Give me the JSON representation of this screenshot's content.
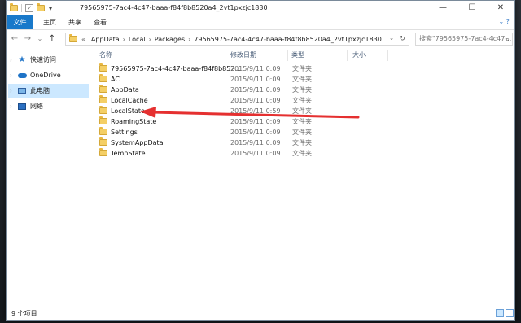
{
  "window": {
    "title": "79565975-7ac4-4c47-baaa-f84f8b8520a4_2vt1pxzjc1830",
    "controls": {
      "minimize": "—",
      "maximize": "☐",
      "close": "✕"
    }
  },
  "quick_access": {
    "dropdown": "▾"
  },
  "ribbon": {
    "tabs": [
      "文件",
      "主页",
      "共享",
      "查看"
    ],
    "expand_glyph": "⌄ ?"
  },
  "address": {
    "back": "←",
    "forward": "→",
    "recent": "⌄",
    "up": "↑",
    "overflow": "«",
    "crumbs": [
      "AppData",
      "Local",
      "Packages",
      "79565975-7ac4-4c47-baaa-f84f8b8520a4_2vt1pxzjc1830"
    ],
    "separator": "›",
    "dropdown": "⌄",
    "refresh": "↻"
  },
  "search": {
    "placeholder": "搜索\"79565975-7ac4-4c47-...",
    "icon": "search-icon"
  },
  "nav": {
    "items": [
      {
        "label": "快速访问",
        "icon": "star-icon"
      },
      {
        "label": "OneDrive",
        "icon": "cloud-icon"
      },
      {
        "label": "此电脑",
        "icon": "computer-icon",
        "selected": true
      },
      {
        "label": "网络",
        "icon": "network-icon"
      }
    ]
  },
  "columns": {
    "name": "名称",
    "date": "修改日期",
    "type": "类型",
    "size": "大小"
  },
  "files": [
    {
      "name": "79565975-7ac4-4c47-baaa-f84f8b852...",
      "date": "2015/9/11 0:09",
      "type": "文件夹"
    },
    {
      "name": "AC",
      "date": "2015/9/11 0:09",
      "type": "文件夹"
    },
    {
      "name": "AppData",
      "date": "2015/9/11 0:09",
      "type": "文件夹"
    },
    {
      "name": "LocalCache",
      "date": "2015/9/11 0:09",
      "type": "文件夹"
    },
    {
      "name": "LocalState",
      "date": "2015/9/11 0:59",
      "type": "文件夹"
    },
    {
      "name": "RoamingState",
      "date": "2015/9/11 0:09",
      "type": "文件夹"
    },
    {
      "name": "Settings",
      "date": "2015/9/11 0:09",
      "type": "文件夹"
    },
    {
      "name": "SystemAppData",
      "date": "2015/9/11 0:09",
      "type": "文件夹"
    },
    {
      "name": "TempState",
      "date": "2015/9/11 0:09",
      "type": "文件夹"
    }
  ],
  "status": {
    "item_count": "9 个项目"
  },
  "annotation": {
    "color": "#e53030"
  }
}
